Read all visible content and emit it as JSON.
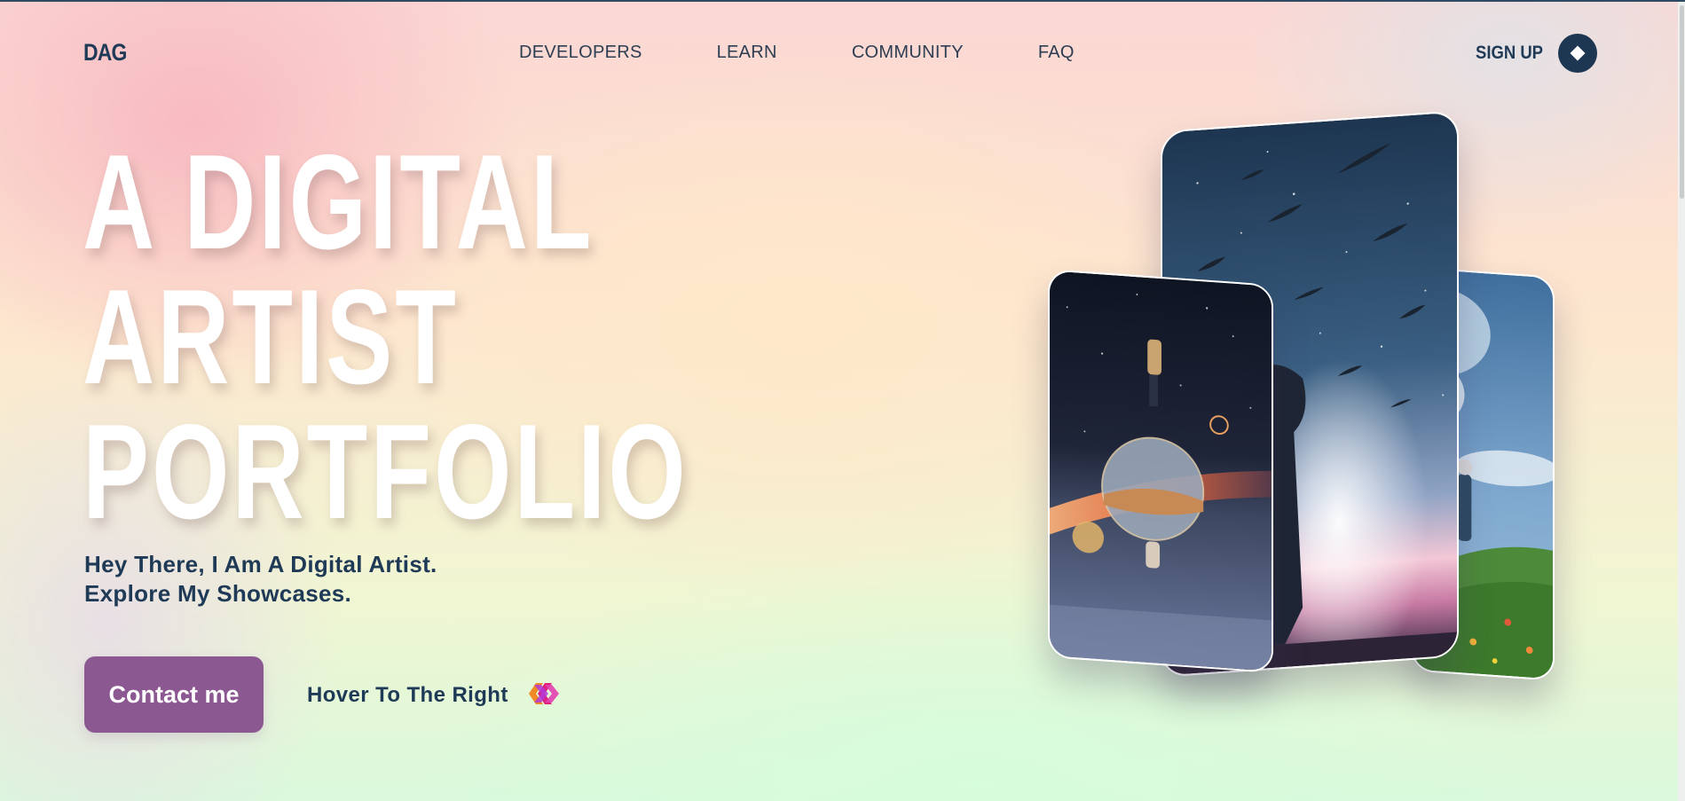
{
  "brand": {
    "logo": "DAG"
  },
  "nav": {
    "links": [
      {
        "label": "DEVELOPERS"
      },
      {
        "label": "LEARN"
      },
      {
        "label": "COMMUNITY"
      },
      {
        "label": "FAQ"
      }
    ],
    "signup_label": "SIGN UP",
    "signup_icon": "diamond-icon"
  },
  "hero": {
    "title_lines": [
      "A DIGITAL",
      "ARTIST",
      "PORTFOLIO"
    ],
    "subtitle_lines": [
      "Hey There, I Am A Digital Artist.",
      "Explore My Showcases."
    ],
    "contact_label": "Contact me",
    "hover_label": "Hover To The Right",
    "hover_icon": "double-arrow-right-icon"
  },
  "showcase": {
    "cards": [
      {
        "name": "artwork-meadow",
        "icon": "image"
      },
      {
        "name": "artwork-night-sky",
        "icon": "image"
      },
      {
        "name": "artwork-reflection-sphere",
        "icon": "image"
      }
    ]
  },
  "colors": {
    "primary_text": "#1f3a56",
    "accent_button": "#8c5892",
    "signup_button": "#1d3752"
  }
}
